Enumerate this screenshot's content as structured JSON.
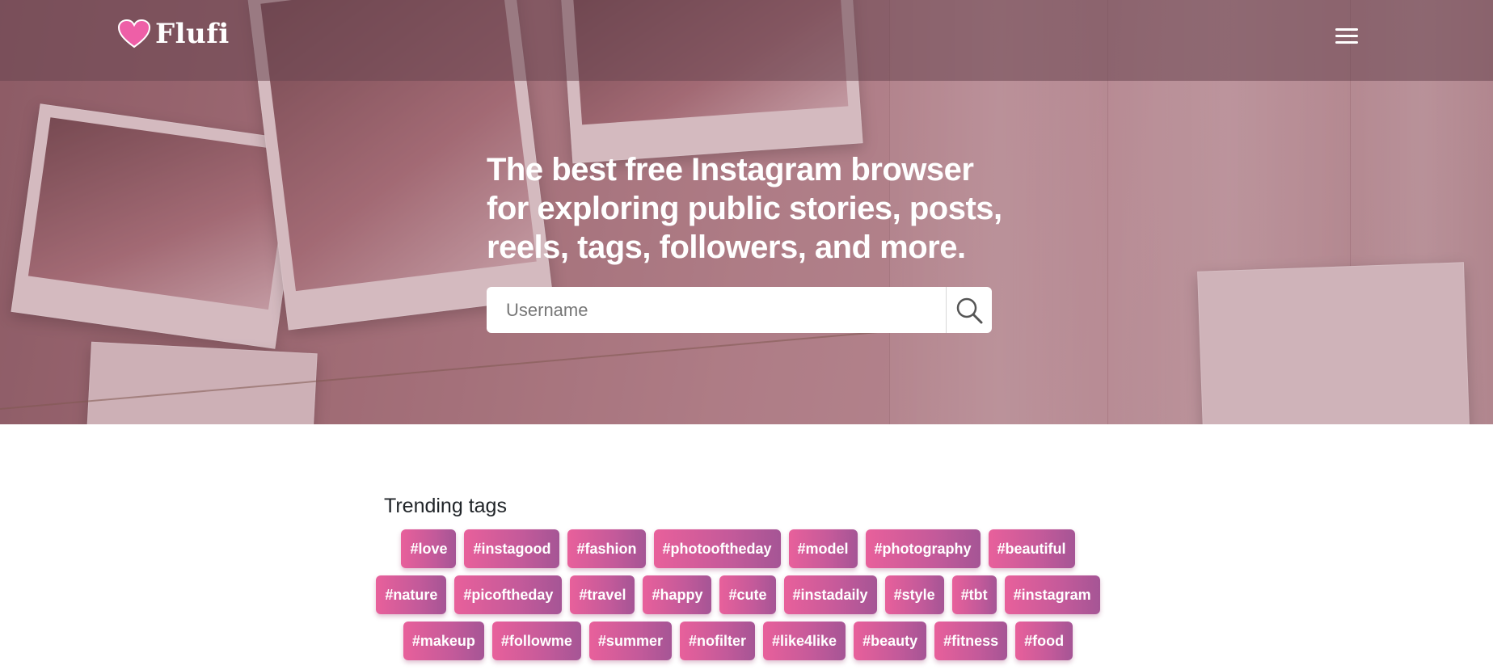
{
  "brand": {
    "name": "Flufi",
    "heart_color": "#ee5fa7"
  },
  "hero": {
    "headline": "The best free Instagram browser for exploring public stories, posts, reels, tags, followers, and more."
  },
  "search": {
    "placeholder": "Username",
    "value": ""
  },
  "trending": {
    "title": "Trending tags",
    "rows": [
      [
        "#love",
        "#instagood",
        "#fashion",
        "#photooftheday",
        "#model",
        "#photography",
        "#beautiful"
      ],
      [
        "#nature",
        "#picoftheday",
        "#travel",
        "#happy",
        "#cute",
        "#instadaily",
        "#style",
        "#tbt",
        "#instagram"
      ],
      [
        "#makeup",
        "#followme",
        "#summer",
        "#nofilter",
        "#like4like",
        "#beauty",
        "#fitness",
        "#food"
      ]
    ]
  },
  "colors": {
    "tag_gradient_start": "#e8609b",
    "tag_gradient_end": "#a55595"
  },
  "icons": {
    "menu": "hamburger-menu-icon",
    "search": "magnifier-icon",
    "logo": "heart-icon"
  }
}
